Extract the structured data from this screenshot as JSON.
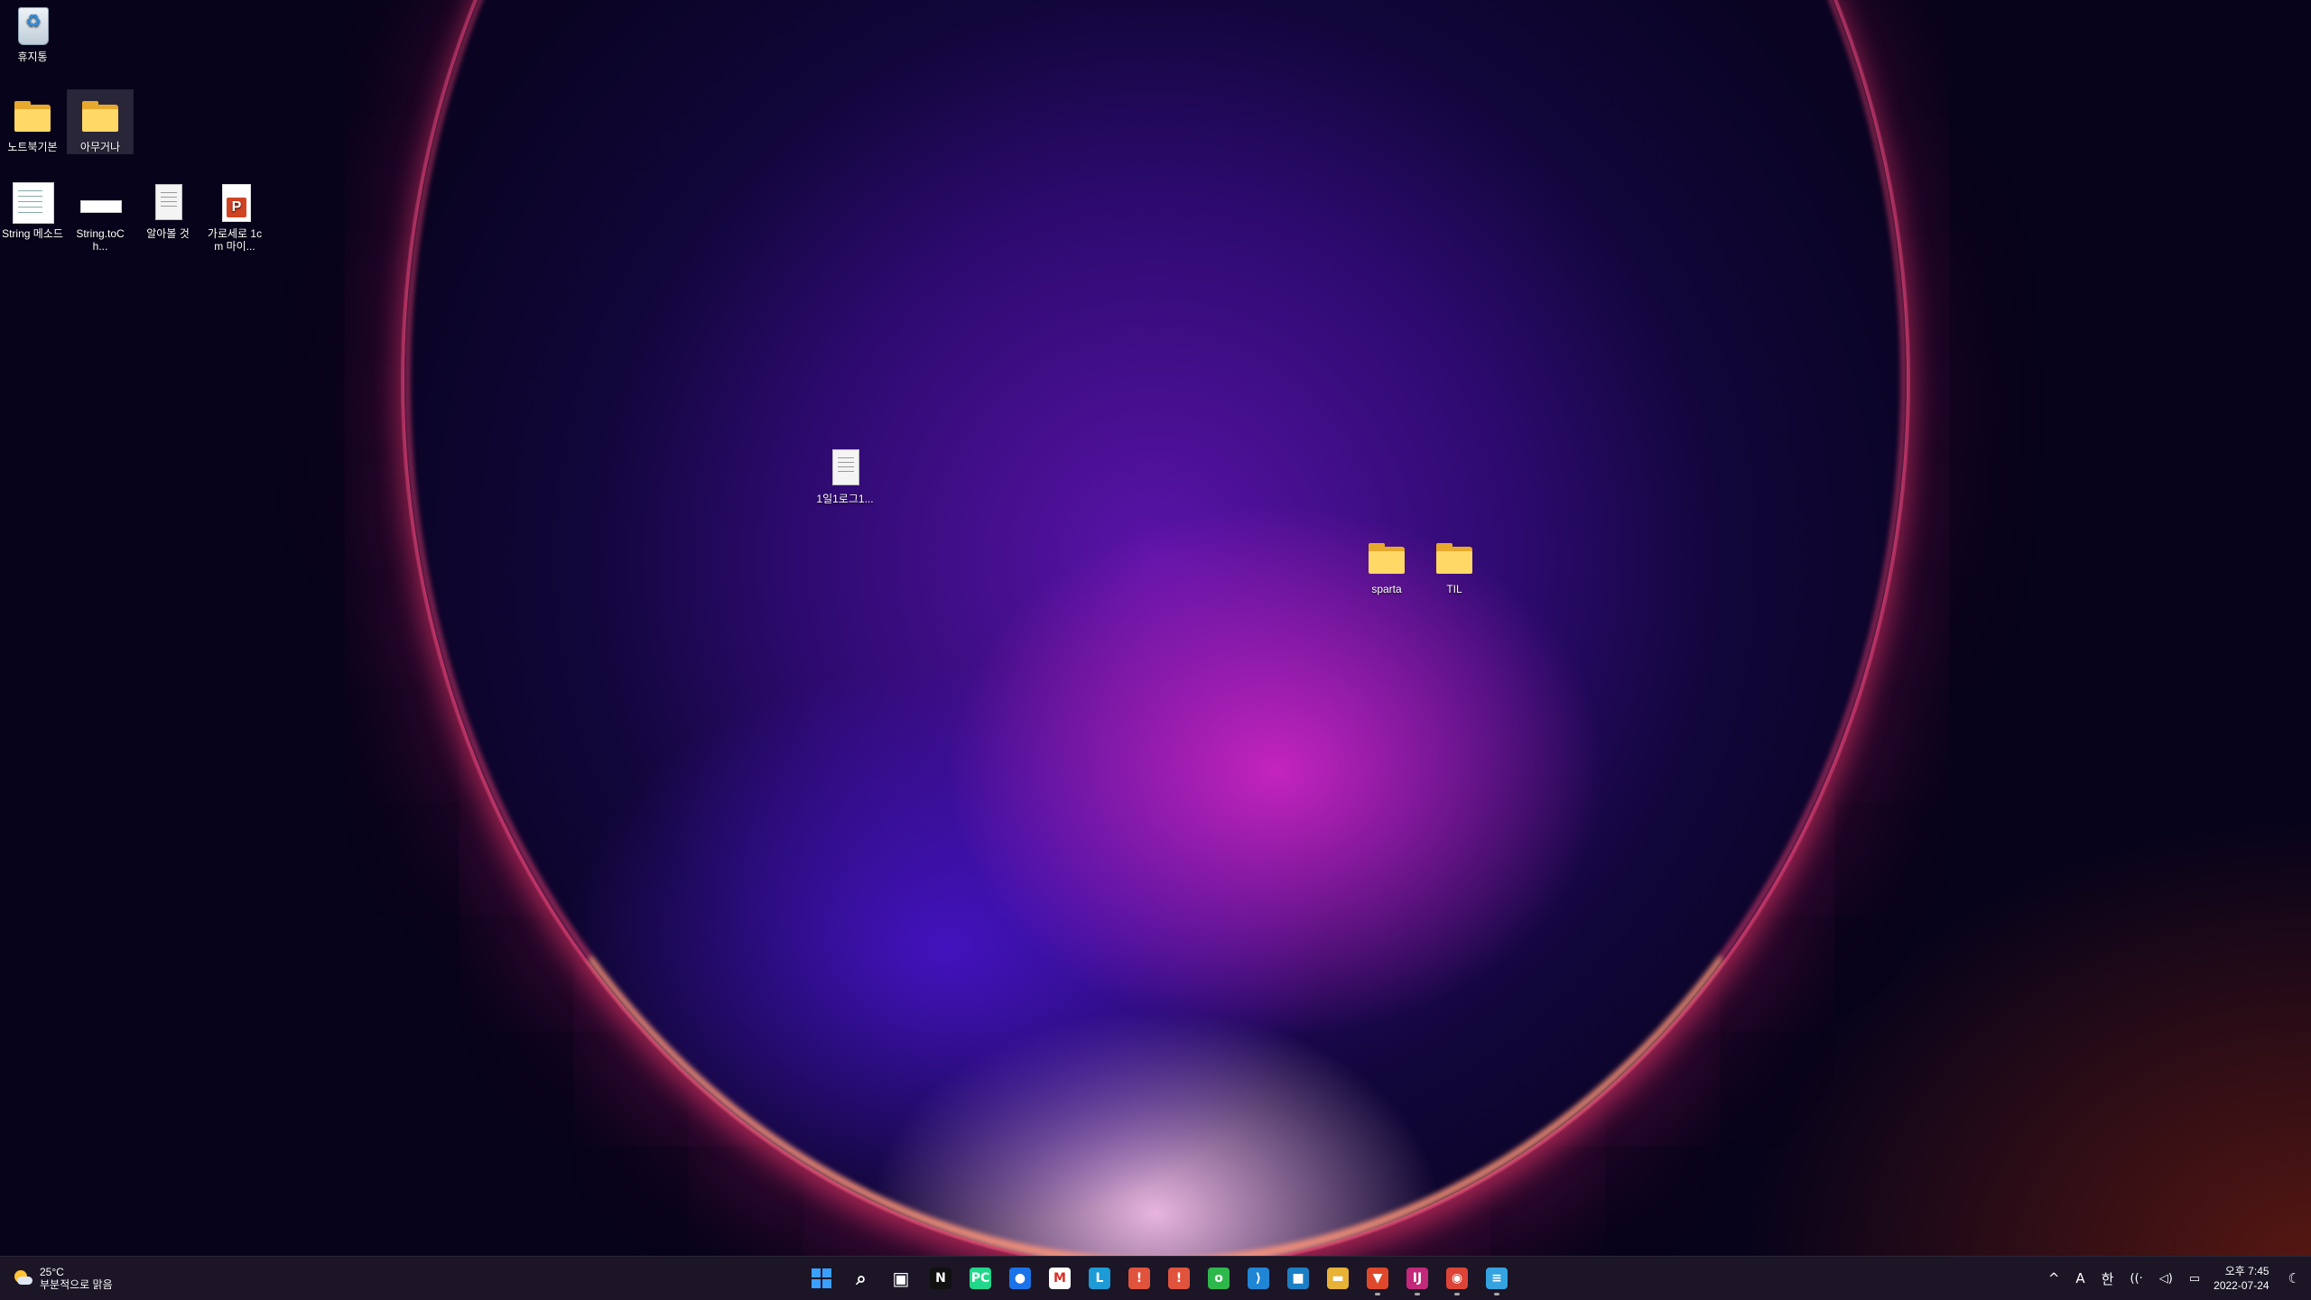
{
  "desktop": {
    "icons": [
      {
        "label": "휴지통"
      },
      {
        "label": "노트북기본"
      },
      {
        "label": "아무거나"
      },
      {
        "label": "String 메소드"
      },
      {
        "label": "String.toCh..."
      },
      {
        "label": "알아볼 것"
      },
      {
        "label": "가로세로 1cm 마이..."
      },
      {
        "label": "1일1로그1..."
      },
      {
        "label": "sparta"
      },
      {
        "label": "TIL"
      }
    ]
  },
  "taskbar": {
    "weather": {
      "temp": "25°C",
      "desc": "부분적으로 맑음"
    },
    "apps": [
      {
        "name": "start",
        "glyph": "",
        "color": "#2f8bff"
      },
      {
        "name": "search",
        "glyph": "⌕",
        "color": "transparent"
      },
      {
        "name": "task-view",
        "glyph": "▣",
        "color": "transparent"
      },
      {
        "name": "netflix",
        "glyph": "N",
        "color": "#111111"
      },
      {
        "name": "pycharm",
        "glyph": "PC",
        "color": "#21d789"
      },
      {
        "name": "maps",
        "glyph": "●",
        "color": "#1a73e8"
      },
      {
        "name": "gmail",
        "glyph": "M",
        "color": "#ffffff"
      },
      {
        "name": "lingo",
        "glyph": "L",
        "color": "#1c9bd6"
      },
      {
        "name": "app-red-1",
        "glyph": "!",
        "color": "#e0533d"
      },
      {
        "name": "app-red-2",
        "glyph": "!",
        "color": "#e0533d"
      },
      {
        "name": "green-app",
        "glyph": "o",
        "color": "#2db84b"
      },
      {
        "name": "vscode",
        "glyph": "⟩",
        "color": "#1f86d6"
      },
      {
        "name": "store",
        "glyph": "■",
        "color": "#1b7fc4"
      },
      {
        "name": "file-explorer",
        "glyph": "▬",
        "color": "#e7b235"
      },
      {
        "name": "brave",
        "glyph": "▼",
        "color": "#e0482b"
      },
      {
        "name": "intellij",
        "glyph": "IJ",
        "color": "#c3287a"
      },
      {
        "name": "chrome",
        "glyph": "◉",
        "color": "#dc4437"
      },
      {
        "name": "notepad",
        "glyph": "≡",
        "color": "#34a3e0"
      }
    ],
    "tray": {
      "chevron": "^",
      "ime_mode": "A",
      "ime_lang": "한",
      "time": "오후 7:45",
      "date": "2022-07-24"
    }
  }
}
